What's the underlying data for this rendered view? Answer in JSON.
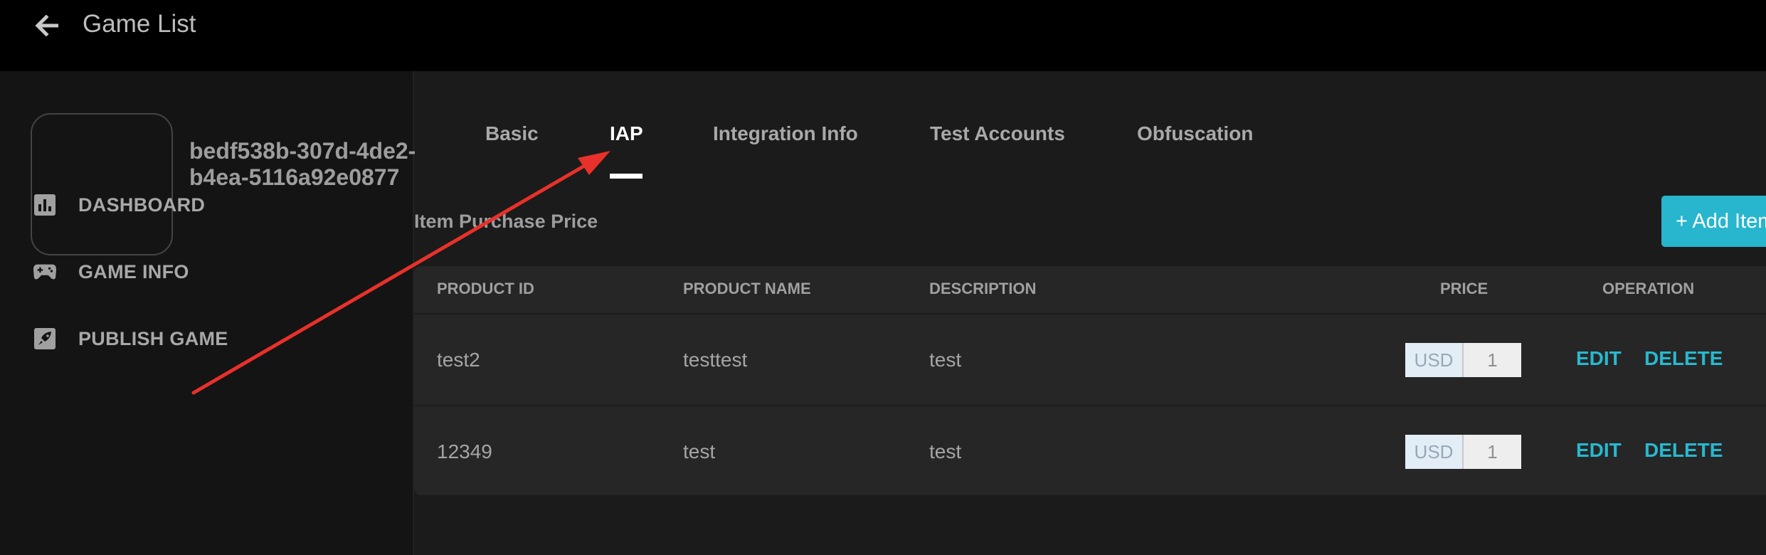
{
  "header": {
    "title": "Game List",
    "back_icon": "arrow-left-icon"
  },
  "sidebar": {
    "game_id": "bedf538b-307d-4de2-b4ea-5116a92e0877",
    "items": [
      {
        "label": "DASHBOARD",
        "icon": "bar-chart-icon"
      },
      {
        "label": "GAME INFO",
        "icon": "gamepad-icon"
      },
      {
        "label": "PUBLISH GAME",
        "icon": "rocket-icon"
      }
    ]
  },
  "tabs": [
    {
      "label": "Basic",
      "active": false
    },
    {
      "label": "IAP",
      "active": true
    },
    {
      "label": "Integration Info",
      "active": false
    },
    {
      "label": "Test Accounts",
      "active": false
    },
    {
      "label": "Obfuscation",
      "active": false
    }
  ],
  "section": {
    "title": "Item Purchase Price",
    "add_button": "+ Add Item"
  },
  "table": {
    "columns": [
      "PRODUCT ID",
      "PRODUCT NAME",
      "DESCRIPTION",
      "PRICE",
      "OPERATION"
    ],
    "rows": [
      {
        "product_id": "test2",
        "product_name": "testtest",
        "description": "test",
        "currency": "USD",
        "price": "1",
        "edit": "EDIT",
        "delete": "DELETE"
      },
      {
        "product_id": "12349",
        "product_name": "test",
        "description": "test",
        "currency": "USD",
        "price": "1",
        "edit": "EDIT",
        "delete": "DELETE"
      }
    ]
  },
  "colors": {
    "accent": "#27b6ce",
    "annotation_arrow": "#e8312a",
    "topbar": "#000000",
    "background": "#1b1b1b"
  }
}
